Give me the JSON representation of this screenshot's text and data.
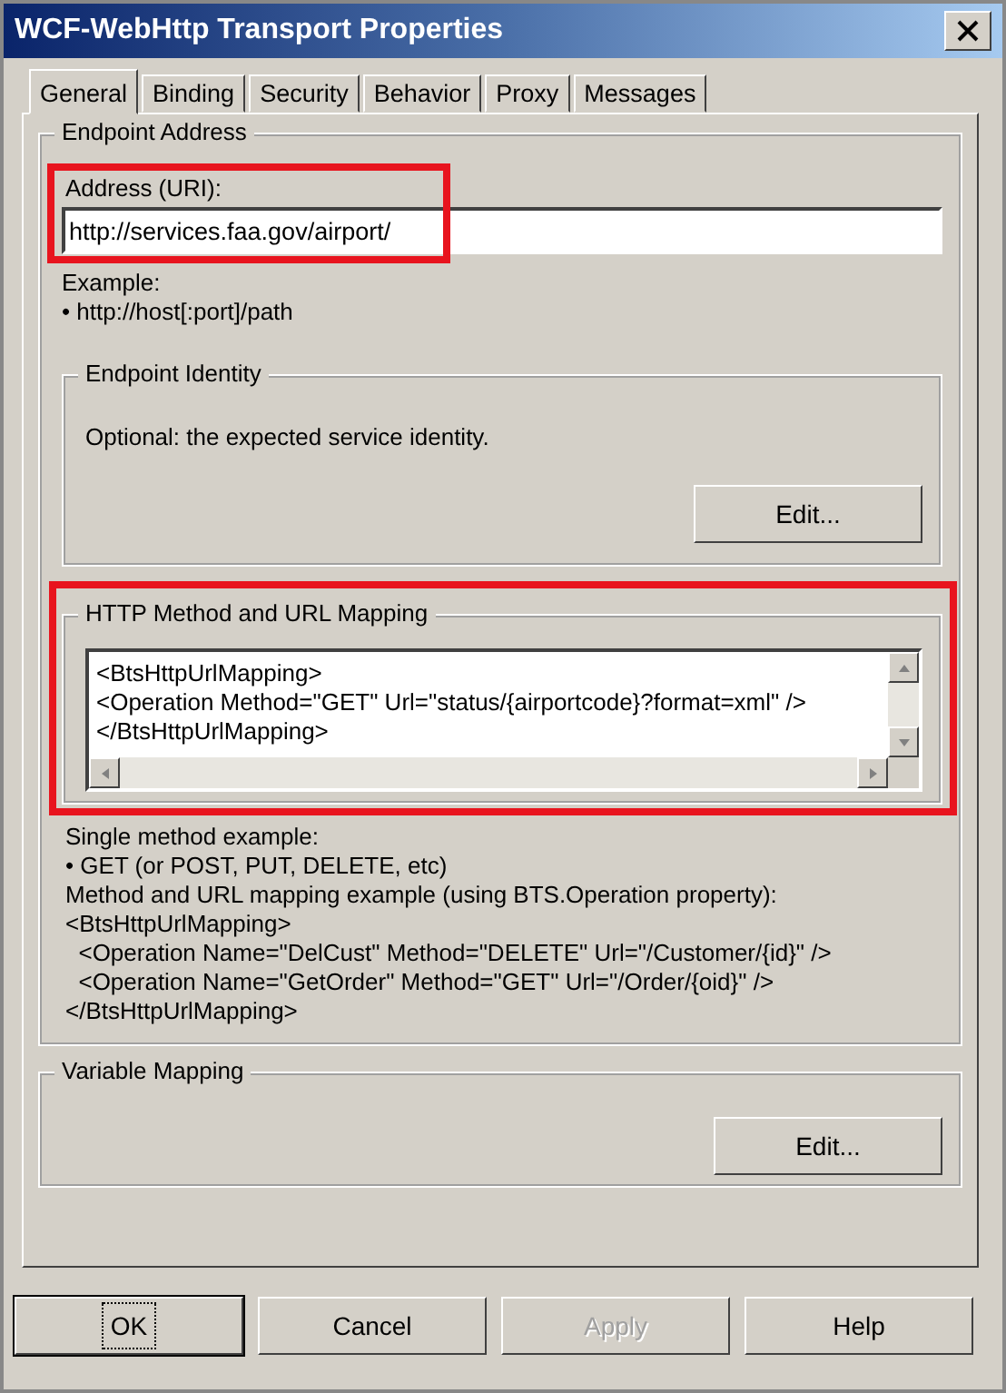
{
  "window": {
    "title": "WCF-WebHttp Transport Properties"
  },
  "tabs": [
    {
      "label": "General",
      "selected": true
    },
    {
      "label": "Binding",
      "selected": false
    },
    {
      "label": "Security",
      "selected": false
    },
    {
      "label": "Behavior",
      "selected": false
    },
    {
      "label": "Proxy",
      "selected": false
    },
    {
      "label": "Messages",
      "selected": false
    }
  ],
  "endpoint_address": {
    "legend": "Endpoint Address",
    "address_label": "Address (URI):",
    "address_value": "http://services.faa.gov/airport/",
    "example_label": "Example:",
    "example_text": "• http://host[:port]/path"
  },
  "endpoint_identity": {
    "legend": "Endpoint Identity",
    "description": "Optional: the expected service identity.",
    "edit_button": "Edit..."
  },
  "http_mapping": {
    "legend": "HTTP Method and URL Mapping",
    "lines": [
      "<BtsHttpUrlMapping>",
      "<Operation Method=\"GET\" Url=\"status/{airportcode}?format=xml\" />",
      "</BtsHttpUrlMapping>"
    ],
    "help_lines": [
      "Single method example:",
      "• GET (or POST, PUT, DELETE, etc)",
      "Method and URL mapping example (using BTS.Operation property):",
      "<BtsHttpUrlMapping>",
      "  <Operation Name=\"DelCust\" Method=\"DELETE\" Url=\"/Customer/{id}\" />",
      "  <Operation Name=\"GetOrder\" Method=\"GET\" Url=\"/Order/{oid}\" />",
      "</BtsHttpUrlMapping>"
    ]
  },
  "variable_mapping": {
    "legend": "Variable Mapping",
    "edit_button": "Edit..."
  },
  "buttons": [
    {
      "label": "OK",
      "disabled": false,
      "default": true
    },
    {
      "label": "Cancel",
      "disabled": false,
      "default": false
    },
    {
      "label": "Apply",
      "disabled": true,
      "default": false
    },
    {
      "label": "Help",
      "disabled": false,
      "default": false
    }
  ]
}
